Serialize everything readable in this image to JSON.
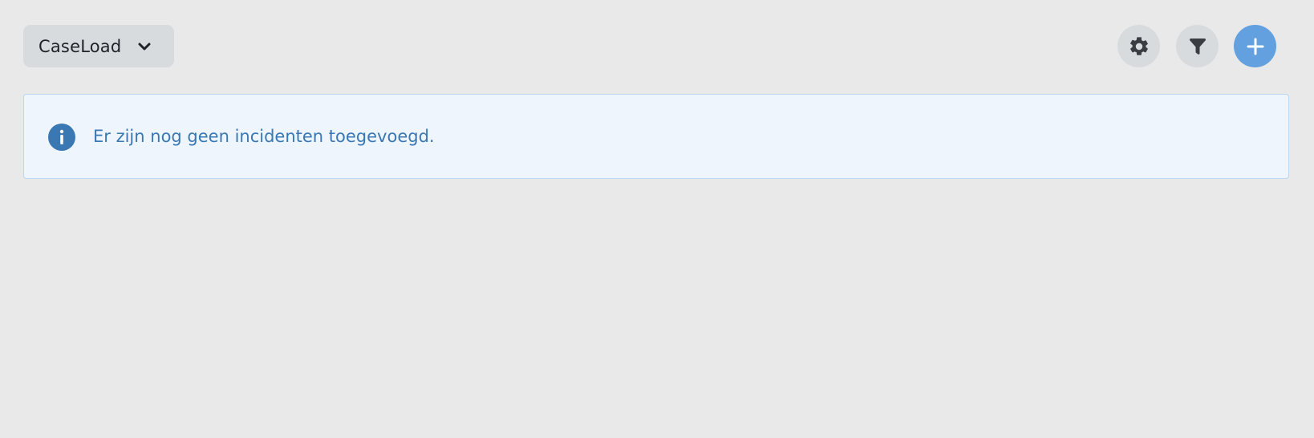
{
  "toolbar": {
    "dropdown": {
      "label": "CaseLoad",
      "icon": "chevron-down-icon"
    },
    "buttons": [
      {
        "name": "settings",
        "icon": "gear-icon",
        "color": "#d8dbde"
      },
      {
        "name": "filter",
        "icon": "filter-icon",
        "color": "#d8dbde"
      },
      {
        "name": "add",
        "icon": "plus-icon",
        "color": "#62a0e0"
      }
    ]
  },
  "alert": {
    "icon": "info-circle-icon",
    "message": "Er zijn nog geen incidenten toegevoegd.",
    "colors": {
      "background": "#eef5fc",
      "border": "#bcd6ee",
      "text": "#3a78b4",
      "icon": "#3a78b4"
    }
  }
}
